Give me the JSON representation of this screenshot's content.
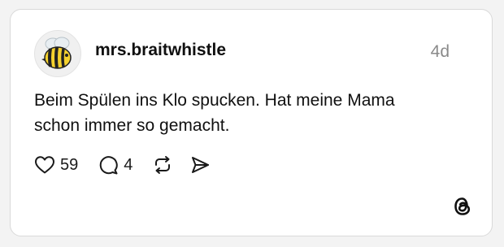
{
  "post": {
    "username": "mrs.braitwhistle",
    "timestamp": "4d",
    "text": "Beim Spülen ins Klo spucken. Hat meine Mama schon immer so gemacht.",
    "likes": "59",
    "replies": "4"
  },
  "icons": {
    "avatar": "bee-icon",
    "like": "heart-icon",
    "reply": "comment-bubble-icon",
    "repost": "repost-arrows-icon",
    "share": "send-paper-plane-icon",
    "brand": "threads-logo-icon"
  },
  "colors": {
    "background": "#f3f3f3",
    "card": "#ffffff",
    "text": "#101010",
    "muted": "#8a8a8a",
    "bee_yellow": "#f4d12e"
  }
}
